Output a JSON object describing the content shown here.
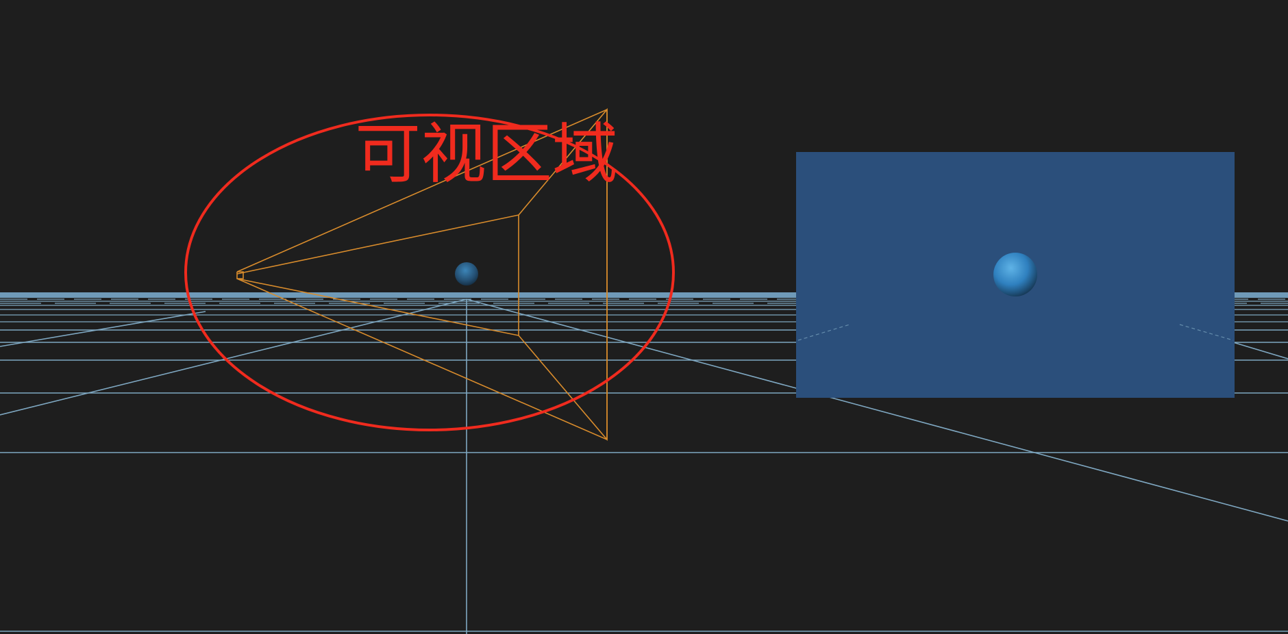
{
  "annotation": {
    "label": "可视区域",
    "color": "#f02b1e"
  },
  "viewport": {
    "background": "#1e1e1e",
    "grid_color": "#7fa8c2",
    "frustum_color": "#d98c2c"
  },
  "preview": {
    "background": "#2b4f7b",
    "sphere_color": "#3a86c0"
  },
  "icons": {
    "scene_sphere": "sphere",
    "preview_sphere": "sphere"
  }
}
